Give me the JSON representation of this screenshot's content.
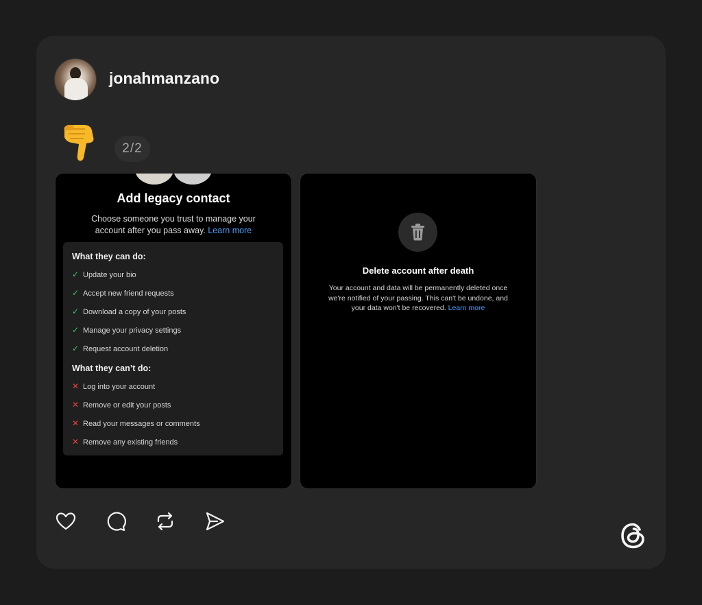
{
  "post": {
    "username": "jonahmanzano",
    "counter": "2/2"
  },
  "slide1": {
    "title": "Add legacy contact",
    "description": "Choose someone you trust to manage your account after you pass away.",
    "learn_more": "Learn more",
    "can_title": "What they can do:",
    "can_items": [
      "Update your bio",
      "Accept new friend requests",
      "Download a copy of your posts",
      "Manage your privacy settings",
      "Request account deletion"
    ],
    "cant_title": "What they can’t do:",
    "cant_items": [
      "Log into your account",
      "Remove or edit your posts",
      "Read your messages or comments",
      "Remove any existing friends"
    ]
  },
  "slide2": {
    "title": "Delete account after death",
    "description": "Your account and data will be permanently deleted once we're notified of your passing. This can't be undone, and your data won't be recovered.",
    "learn_more": "Learn more"
  },
  "colors": {
    "background": "#1c1c1c",
    "card": "#262626",
    "check": "#35c96b",
    "cross": "#e8413b",
    "link": "#4a9df8"
  },
  "icons": {
    "emoji": "backhand-index-pointing-down-icon",
    "trash": "trash-icon",
    "like": "heart-icon",
    "comment": "comment-bubble-icon",
    "repost": "repost-icon",
    "share": "send-icon",
    "brand": "threads-logo-icon"
  }
}
